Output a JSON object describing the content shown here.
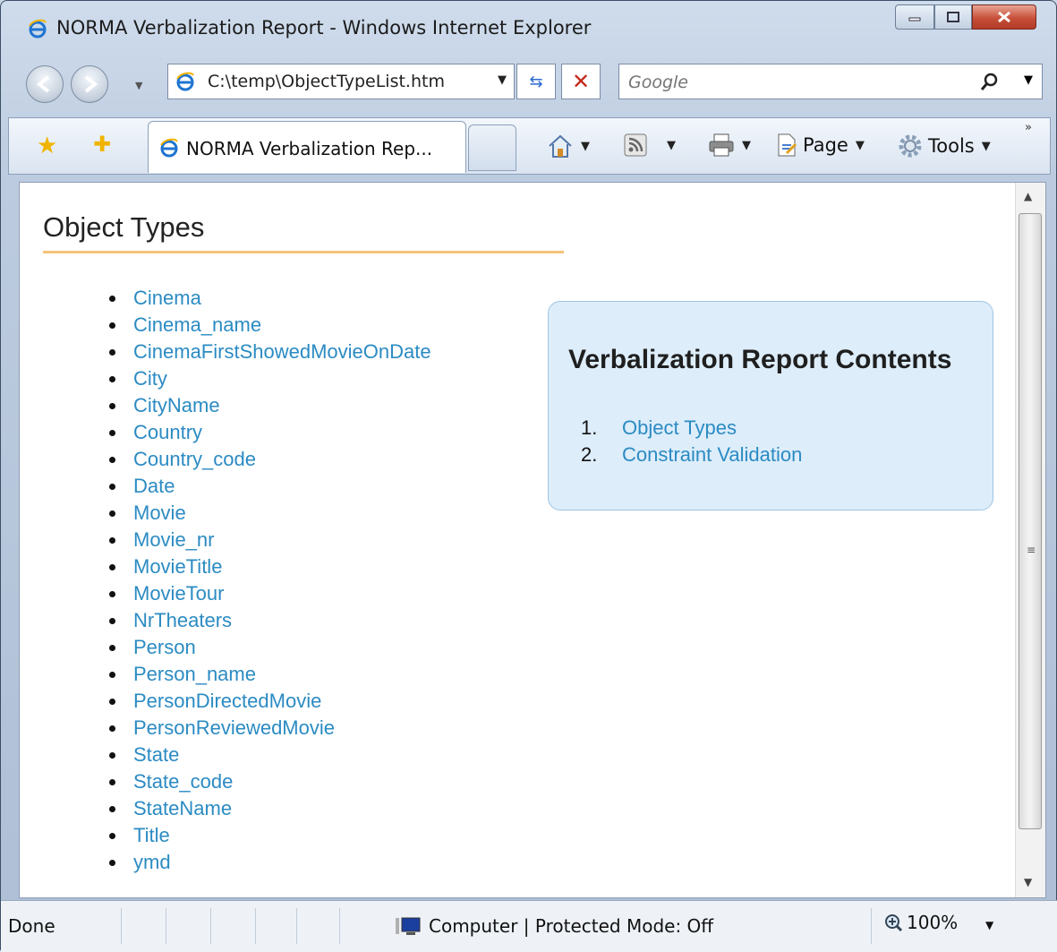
{
  "window": {
    "title": "NORMA Verbalization Report - Windows Internet Explorer"
  },
  "address_bar": {
    "url": "C:\\temp\\ObjectTypeList.htm"
  },
  "search": {
    "placeholder": "Google"
  },
  "tab": {
    "label": "NORMA Verbalization Rep..."
  },
  "command_bar": {
    "page_label": "Page",
    "tools_label": "Tools"
  },
  "page": {
    "heading": "Object Types",
    "object_types": [
      "Cinema",
      "Cinema_name",
      "CinemaFirstShowedMovieOnDate",
      "City",
      "CityName",
      "Country",
      "Country_code",
      "Date",
      "Movie",
      "Movie_nr",
      "MovieTitle",
      "MovieTour",
      "NrTheaters",
      "Person",
      "Person_name",
      "PersonDirectedMovie",
      "PersonReviewedMovie",
      "State",
      "State_code",
      "StateName",
      "Title",
      "ymd"
    ],
    "contents": {
      "title": "Verbalization Report Contents",
      "items": [
        {
          "number": "1.",
          "label": "Object Types"
        },
        {
          "number": "2.",
          "label": "Constraint Validation"
        }
      ]
    }
  },
  "status_bar": {
    "status": "Done",
    "zone": "Computer | Protected Mode: Off",
    "zoom": "100%"
  },
  "colors": {
    "link": "#2b8bc3",
    "heading_underline": "#f6c27a",
    "contents_background": "#ddedfa"
  }
}
